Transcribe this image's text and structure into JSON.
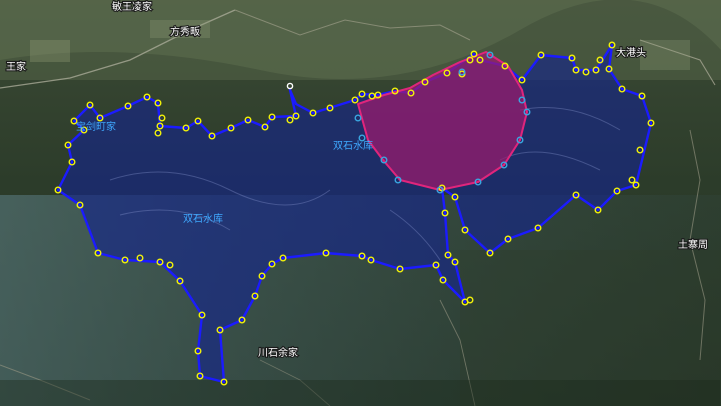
{
  "map": {
    "place_labels": [
      "敏王凌家",
      "方秀畈",
      "王家",
      "宝剑町家",
      "大港头",
      "土寨周",
      "川石余家"
    ],
    "reservoir_labels": [
      "双石水库",
      "双石水库"
    ],
    "colors": {
      "reservoir_fill": "#14238c",
      "reservoir_outline": "#1b1bff",
      "sub_area_fill": "#a01a6e",
      "sub_area_outline": "#e0257c",
      "vertex_yellow": "#f2f20a",
      "vertex_cyan": "#3aa6e0",
      "vertex_white": "#ffffff"
    }
  }
}
